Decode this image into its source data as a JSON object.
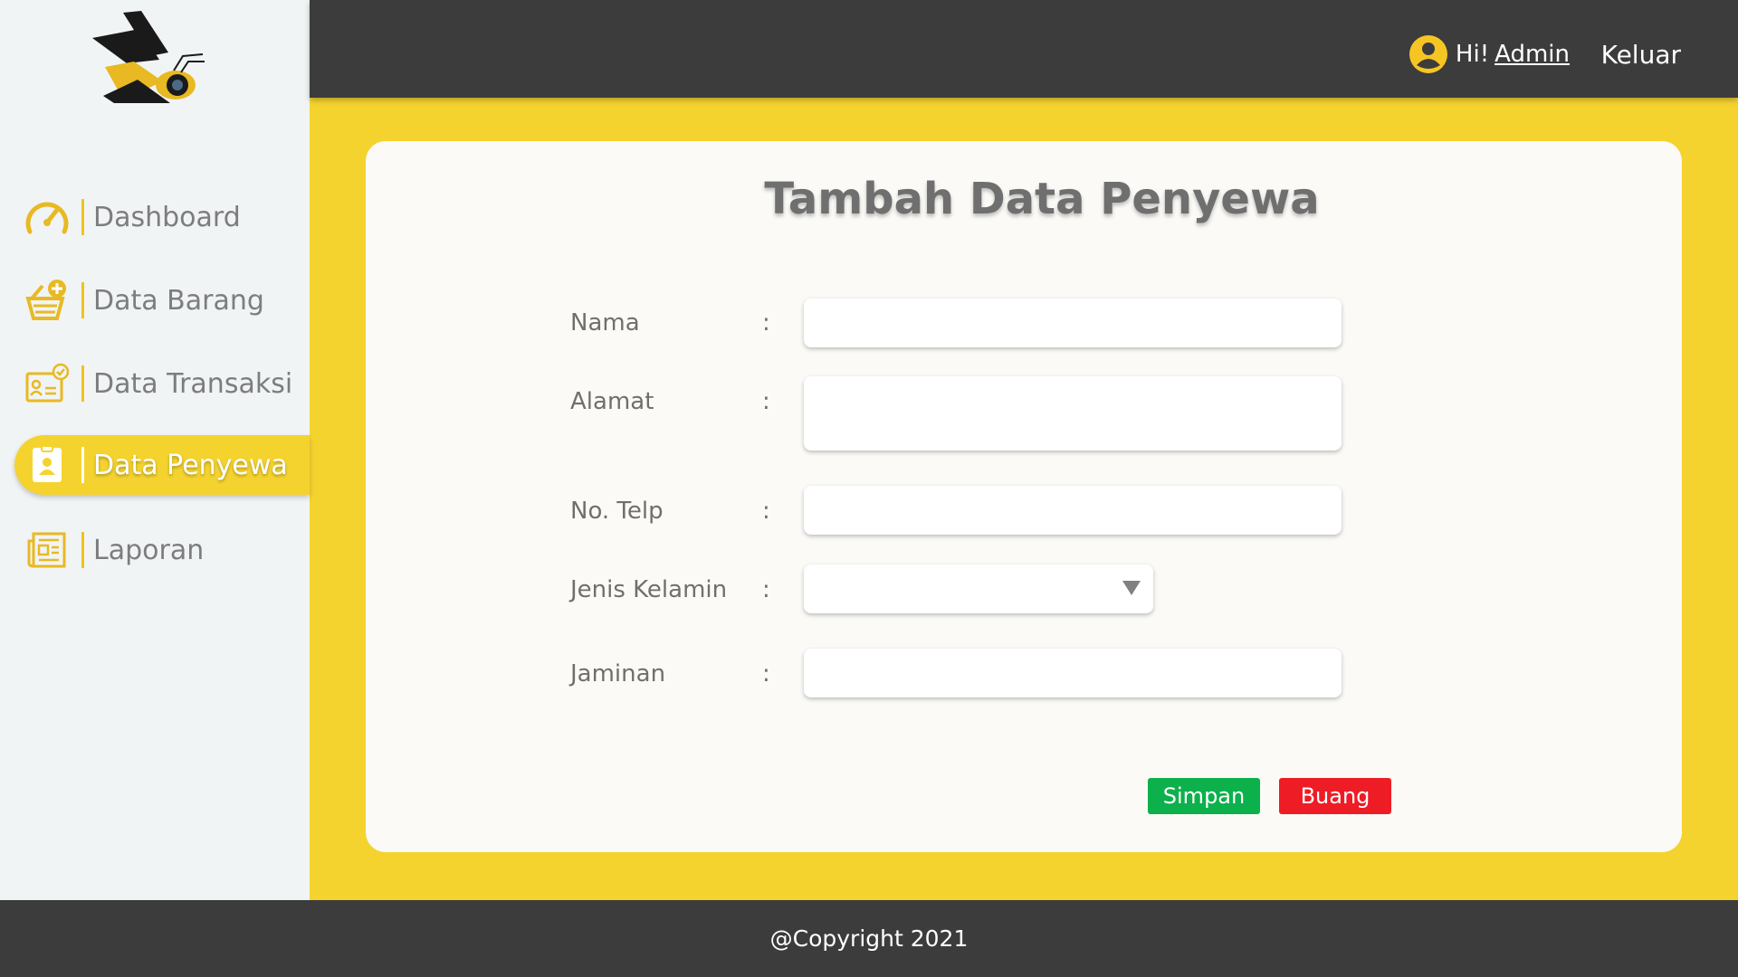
{
  "sidebar": {
    "items": [
      {
        "label": "Dashboard",
        "icon": "speedometer-icon",
        "active": false
      },
      {
        "label": "Data Barang",
        "icon": "basket-add-icon",
        "active": false
      },
      {
        "label": "Data Transaksi",
        "icon": "id-card-check-icon",
        "active": false
      },
      {
        "label": "Data Penyewa",
        "icon": "person-badge-icon",
        "active": true
      },
      {
        "label": "Laporan",
        "icon": "newspaper-icon",
        "active": false
      }
    ]
  },
  "header": {
    "greeting": "Hi!",
    "user": "Admin",
    "logout": "Keluar"
  },
  "form": {
    "title": "Tambah Data Penyewa",
    "fields": [
      {
        "label": "Nama",
        "value": "",
        "type": "text"
      },
      {
        "label": "Alamat",
        "value": "",
        "type": "textarea"
      },
      {
        "label": "No. Telp",
        "value": "",
        "type": "text"
      },
      {
        "label": "Jenis Kelamin",
        "value": "",
        "type": "select"
      },
      {
        "label": "Jaminan",
        "value": "",
        "type": "text"
      }
    ],
    "colon": ":",
    "save": "Simpan",
    "discard": "Buang"
  },
  "footer": {
    "copyright": "@Copyright 2021"
  },
  "colors": {
    "accent": "#f5d32f",
    "dark": "#3c3c3c",
    "sidebar_bg": "#f1f4f5",
    "save": "#0cb14b",
    "discard": "#ee1c25"
  }
}
